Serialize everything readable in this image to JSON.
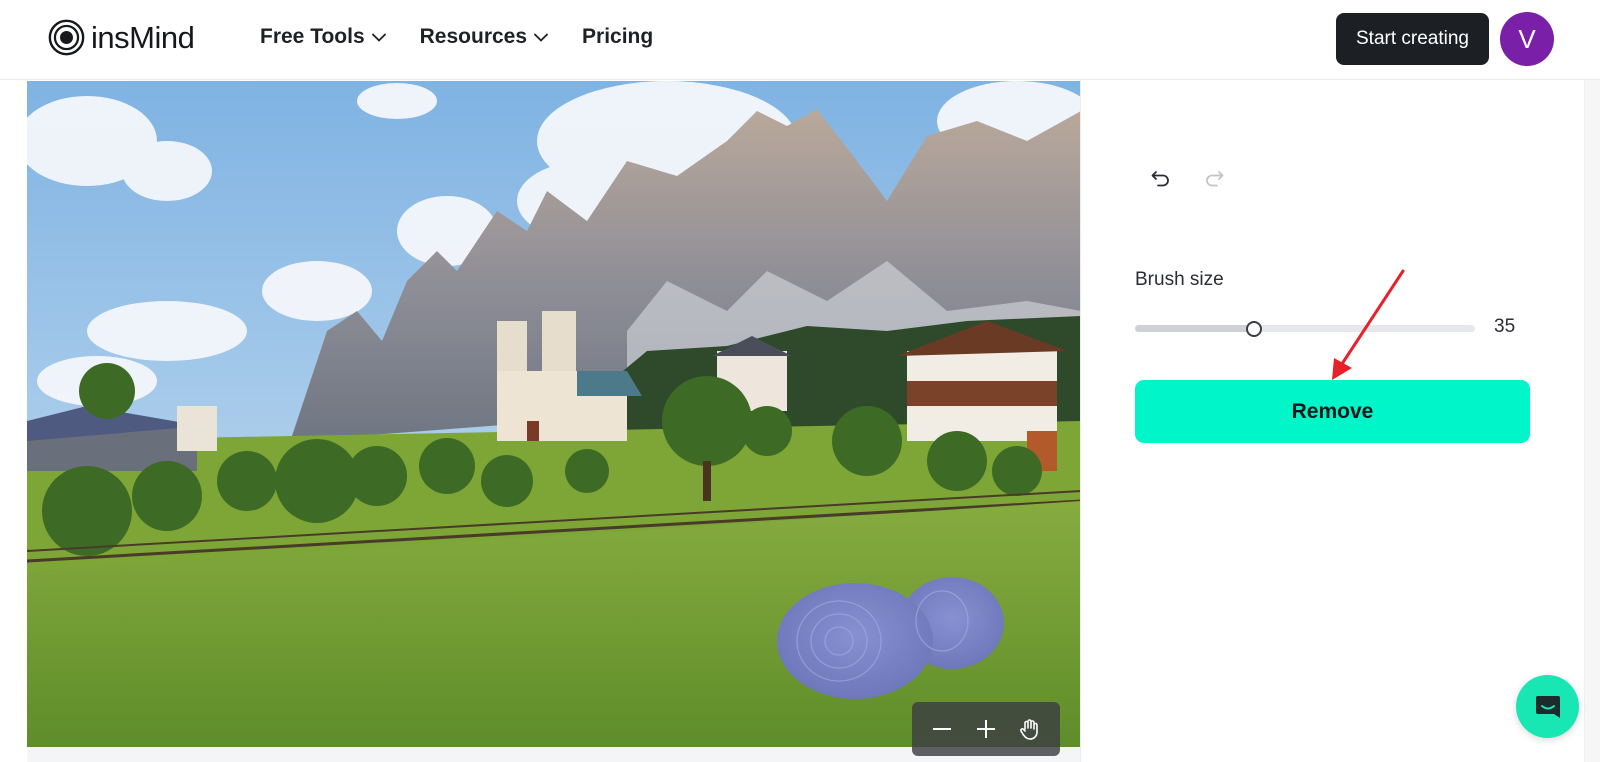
{
  "header": {
    "logo_text": "insMind",
    "nav": [
      {
        "label": "Free Tools",
        "has_dropdown": true
      },
      {
        "label": "Resources",
        "has_dropdown": true
      },
      {
        "label": "Pricing",
        "has_dropdown": false
      }
    ],
    "start_button": "Start creating",
    "avatar_letter": "V"
  },
  "panel": {
    "brush_label": "Brush size",
    "brush_value": "35",
    "brush_fraction": 0.35,
    "remove_button": "Remove"
  },
  "icons": {
    "undo": "undo-icon",
    "redo": "redo-icon",
    "zoom_out": "minus-icon",
    "zoom_in": "plus-icon",
    "pan": "hand-icon",
    "chat": "chat-icon"
  },
  "colors": {
    "accent": "#00f5c8",
    "dark_button": "#1c1f24",
    "avatar": "#7a1fa8",
    "brush_mask": "#7f86d9",
    "annotation_arrow": "#e8202a"
  }
}
